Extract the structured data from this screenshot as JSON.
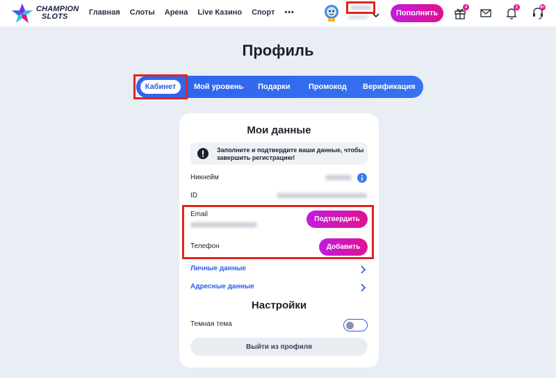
{
  "header": {
    "logo": {
      "line1": "CHAMPION",
      "line2": "SLOTS"
    },
    "nav": [
      {
        "label": "Главная"
      },
      {
        "label": "Слоты"
      },
      {
        "label": "Арена"
      },
      {
        "label": "Live Казино"
      },
      {
        "label": "Спорт"
      },
      {
        "label": "•••"
      }
    ],
    "deposit_label": "Пополнить",
    "icons": [
      {
        "name": "gift-icon",
        "badge": "4"
      },
      {
        "name": "mail-icon",
        "badge": ""
      },
      {
        "name": "bell-icon",
        "badge": "2"
      },
      {
        "name": "support-icon",
        "badge": "9+"
      }
    ]
  },
  "page": {
    "title": "Профиль"
  },
  "tabs": [
    {
      "label": "Кабинет",
      "active": true
    },
    {
      "label": "Мой уровень",
      "active": false
    },
    {
      "label": "Подарки",
      "active": false
    },
    {
      "label": "Промокод",
      "active": false
    },
    {
      "label": "Верификация",
      "active": false
    }
  ],
  "card": {
    "title": "Мои данные",
    "notice": "Заполните и подтвердите ваши данные, чтобы завершить регистрацию!",
    "nickname_label": "Никнейм",
    "id_label": "ID",
    "email_label": "Email",
    "confirm_label": "Подтвердить",
    "phone_label": "Телефон",
    "add_label": "Добавить",
    "personal_link": "Личные данные",
    "address_link": "Адресные данные",
    "settings_title": "Настройки",
    "dark_theme_label": "Темная тема",
    "dark_theme_enabled": false,
    "logout_label": "Выйти из профиля"
  },
  "colors": {
    "accent_blue": "#2f63f0",
    "accent_pink": "#e0128e",
    "highlight_red": "#e0241e"
  }
}
